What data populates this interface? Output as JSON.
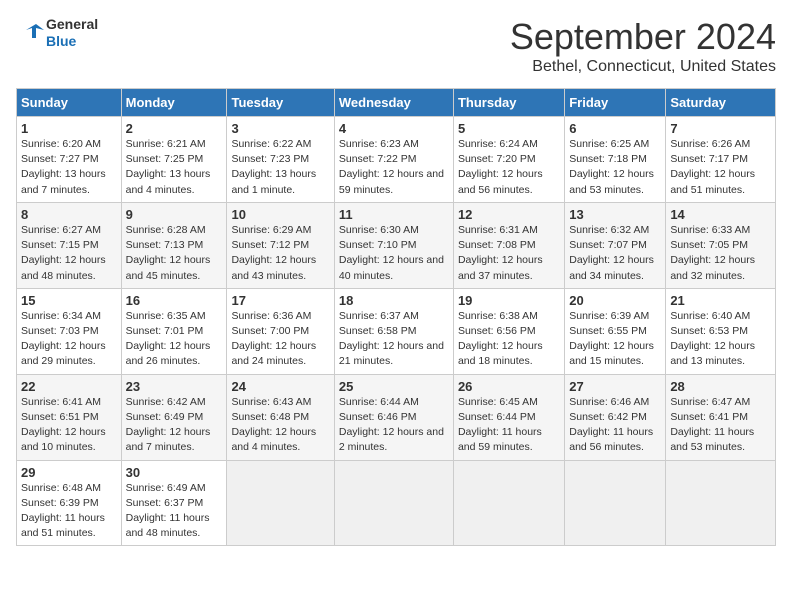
{
  "logo": {
    "line1": "General",
    "line2": "Blue"
  },
  "title": "September 2024",
  "subtitle": "Bethel, Connecticut, United States",
  "days_of_week": [
    "Sunday",
    "Monday",
    "Tuesday",
    "Wednesday",
    "Thursday",
    "Friday",
    "Saturday"
  ],
  "weeks": [
    [
      {
        "day": "1",
        "sunrise": "Sunrise: 6:20 AM",
        "sunset": "Sunset: 7:27 PM",
        "daylight": "Daylight: 13 hours and 7 minutes."
      },
      {
        "day": "2",
        "sunrise": "Sunrise: 6:21 AM",
        "sunset": "Sunset: 7:25 PM",
        "daylight": "Daylight: 13 hours and 4 minutes."
      },
      {
        "day": "3",
        "sunrise": "Sunrise: 6:22 AM",
        "sunset": "Sunset: 7:23 PM",
        "daylight": "Daylight: 13 hours and 1 minute."
      },
      {
        "day": "4",
        "sunrise": "Sunrise: 6:23 AM",
        "sunset": "Sunset: 7:22 PM",
        "daylight": "Daylight: 12 hours and 59 minutes."
      },
      {
        "day": "5",
        "sunrise": "Sunrise: 6:24 AM",
        "sunset": "Sunset: 7:20 PM",
        "daylight": "Daylight: 12 hours and 56 minutes."
      },
      {
        "day": "6",
        "sunrise": "Sunrise: 6:25 AM",
        "sunset": "Sunset: 7:18 PM",
        "daylight": "Daylight: 12 hours and 53 minutes."
      },
      {
        "day": "7",
        "sunrise": "Sunrise: 6:26 AM",
        "sunset": "Sunset: 7:17 PM",
        "daylight": "Daylight: 12 hours and 51 minutes."
      }
    ],
    [
      {
        "day": "8",
        "sunrise": "Sunrise: 6:27 AM",
        "sunset": "Sunset: 7:15 PM",
        "daylight": "Daylight: 12 hours and 48 minutes."
      },
      {
        "day": "9",
        "sunrise": "Sunrise: 6:28 AM",
        "sunset": "Sunset: 7:13 PM",
        "daylight": "Daylight: 12 hours and 45 minutes."
      },
      {
        "day": "10",
        "sunrise": "Sunrise: 6:29 AM",
        "sunset": "Sunset: 7:12 PM",
        "daylight": "Daylight: 12 hours and 43 minutes."
      },
      {
        "day": "11",
        "sunrise": "Sunrise: 6:30 AM",
        "sunset": "Sunset: 7:10 PM",
        "daylight": "Daylight: 12 hours and 40 minutes."
      },
      {
        "day": "12",
        "sunrise": "Sunrise: 6:31 AM",
        "sunset": "Sunset: 7:08 PM",
        "daylight": "Daylight: 12 hours and 37 minutes."
      },
      {
        "day": "13",
        "sunrise": "Sunrise: 6:32 AM",
        "sunset": "Sunset: 7:07 PM",
        "daylight": "Daylight: 12 hours and 34 minutes."
      },
      {
        "day": "14",
        "sunrise": "Sunrise: 6:33 AM",
        "sunset": "Sunset: 7:05 PM",
        "daylight": "Daylight: 12 hours and 32 minutes."
      }
    ],
    [
      {
        "day": "15",
        "sunrise": "Sunrise: 6:34 AM",
        "sunset": "Sunset: 7:03 PM",
        "daylight": "Daylight: 12 hours and 29 minutes."
      },
      {
        "day": "16",
        "sunrise": "Sunrise: 6:35 AM",
        "sunset": "Sunset: 7:01 PM",
        "daylight": "Daylight: 12 hours and 26 minutes."
      },
      {
        "day": "17",
        "sunrise": "Sunrise: 6:36 AM",
        "sunset": "Sunset: 7:00 PM",
        "daylight": "Daylight: 12 hours and 24 minutes."
      },
      {
        "day": "18",
        "sunrise": "Sunrise: 6:37 AM",
        "sunset": "Sunset: 6:58 PM",
        "daylight": "Daylight: 12 hours and 21 minutes."
      },
      {
        "day": "19",
        "sunrise": "Sunrise: 6:38 AM",
        "sunset": "Sunset: 6:56 PM",
        "daylight": "Daylight: 12 hours and 18 minutes."
      },
      {
        "day": "20",
        "sunrise": "Sunrise: 6:39 AM",
        "sunset": "Sunset: 6:55 PM",
        "daylight": "Daylight: 12 hours and 15 minutes."
      },
      {
        "day": "21",
        "sunrise": "Sunrise: 6:40 AM",
        "sunset": "Sunset: 6:53 PM",
        "daylight": "Daylight: 12 hours and 13 minutes."
      }
    ],
    [
      {
        "day": "22",
        "sunrise": "Sunrise: 6:41 AM",
        "sunset": "Sunset: 6:51 PM",
        "daylight": "Daylight: 12 hours and 10 minutes."
      },
      {
        "day": "23",
        "sunrise": "Sunrise: 6:42 AM",
        "sunset": "Sunset: 6:49 PM",
        "daylight": "Daylight: 12 hours and 7 minutes."
      },
      {
        "day": "24",
        "sunrise": "Sunrise: 6:43 AM",
        "sunset": "Sunset: 6:48 PM",
        "daylight": "Daylight: 12 hours and 4 minutes."
      },
      {
        "day": "25",
        "sunrise": "Sunrise: 6:44 AM",
        "sunset": "Sunset: 6:46 PM",
        "daylight": "Daylight: 12 hours and 2 minutes."
      },
      {
        "day": "26",
        "sunrise": "Sunrise: 6:45 AM",
        "sunset": "Sunset: 6:44 PM",
        "daylight": "Daylight: 11 hours and 59 minutes."
      },
      {
        "day": "27",
        "sunrise": "Sunrise: 6:46 AM",
        "sunset": "Sunset: 6:42 PM",
        "daylight": "Daylight: 11 hours and 56 minutes."
      },
      {
        "day": "28",
        "sunrise": "Sunrise: 6:47 AM",
        "sunset": "Sunset: 6:41 PM",
        "daylight": "Daylight: 11 hours and 53 minutes."
      }
    ],
    [
      {
        "day": "29",
        "sunrise": "Sunrise: 6:48 AM",
        "sunset": "Sunset: 6:39 PM",
        "daylight": "Daylight: 11 hours and 51 minutes."
      },
      {
        "day": "30",
        "sunrise": "Sunrise: 6:49 AM",
        "sunset": "Sunset: 6:37 PM",
        "daylight": "Daylight: 11 hours and 48 minutes."
      },
      null,
      null,
      null,
      null,
      null
    ]
  ]
}
